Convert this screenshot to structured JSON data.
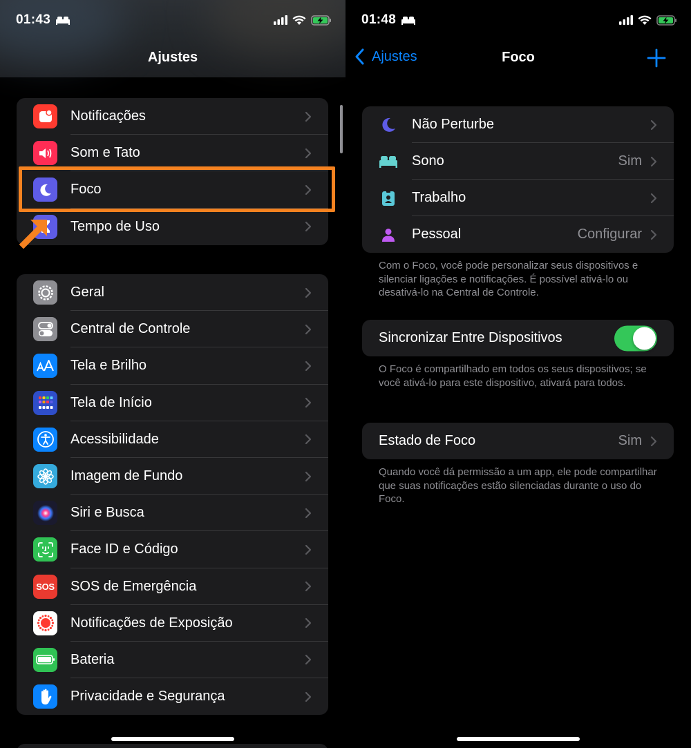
{
  "left_screen": {
    "status_bar": {
      "time": "01:43"
    },
    "nav": {
      "title": "Ajustes"
    },
    "group1": [
      {
        "label": "Notificações",
        "icon": "notifications-icon",
        "color": "#ff3b30"
      },
      {
        "label": "Som e Tato",
        "icon": "speaker-icon",
        "color": "#ff2d55"
      },
      {
        "label": "Foco",
        "icon": "moon-icon",
        "color": "#5e5ce6"
      },
      {
        "label": "Tempo de Uso",
        "icon": "hourglass-icon",
        "color": "#5e5ce6"
      }
    ],
    "group2": [
      {
        "label": "Geral",
        "icon": "gear-icon",
        "color": "#8e8e93"
      },
      {
        "label": "Central de Controle",
        "icon": "toggles-icon",
        "color": "#8e8e93"
      },
      {
        "label": "Tela e Brilho",
        "icon": "text-size-icon",
        "color": "#0a84ff"
      },
      {
        "label": "Tela de Início",
        "icon": "home-grid-icon",
        "color": "#2f4ec9"
      },
      {
        "label": "Acessibilidade",
        "icon": "accessibility-icon",
        "color": "#0a84ff"
      },
      {
        "label": "Imagem de Fundo",
        "icon": "wallpaper-flower-icon",
        "color": "#35aadc"
      },
      {
        "label": "Siri e Busca",
        "icon": "siri-icon",
        "color": "#1a1a2e"
      },
      {
        "label": "Face ID e Código",
        "icon": "face-id-icon",
        "color": "#30c254"
      },
      {
        "label": "SOS de Emergência",
        "icon": "sos-icon",
        "color": "#e93a30",
        "text": "SOS"
      },
      {
        "label": "Notificações de Exposição",
        "icon": "exposure-icon",
        "color": "#ffffff"
      },
      {
        "label": "Bateria",
        "icon": "battery-icon",
        "color": "#30c254"
      },
      {
        "label": "Privacidade e Segurança",
        "icon": "hand-icon",
        "color": "#0a84ff"
      }
    ],
    "annotation_color": "#f58220"
  },
  "right_screen": {
    "status_bar": {
      "time": "01:48"
    },
    "nav": {
      "back_label": "Ajustes",
      "title": "Foco"
    },
    "focus_modes": [
      {
        "label": "Não Perturbe",
        "value": "",
        "icon": "moon-icon",
        "color": "#5e5ce6"
      },
      {
        "label": "Sono",
        "value": "Sim",
        "icon": "bed-icon",
        "color": "#64d2d0"
      },
      {
        "label": "Trabalho",
        "value": "",
        "icon": "id-badge-icon",
        "color": "#5ac8d8"
      },
      {
        "label": "Pessoal",
        "value": "Configurar",
        "icon": "person-icon",
        "color": "#bf5af2"
      }
    ],
    "focus_footnote": "Com o Foco, você pode personalizar seus dispositivos e silenciar ligações e notificações. É possível ativá-lo ou desativá-lo na Central de Controle.",
    "sync": {
      "label": "Sincronizar Entre Dispositivos",
      "enabled": true
    },
    "sync_footnote": "O Foco é compartilhado em todos os seus dispositivos; se você ativá-lo para este dispositivo, ativará para todos.",
    "focus_status": {
      "label": "Estado de Foco",
      "value": "Sim"
    },
    "focus_status_footnote": "Quando você dá permissão a um app, ele pode compartilhar que suas notificações estão silenciadas durante o uso do Foco.",
    "accent_color": "#0a84ff",
    "toggle_color": "#34c759"
  }
}
